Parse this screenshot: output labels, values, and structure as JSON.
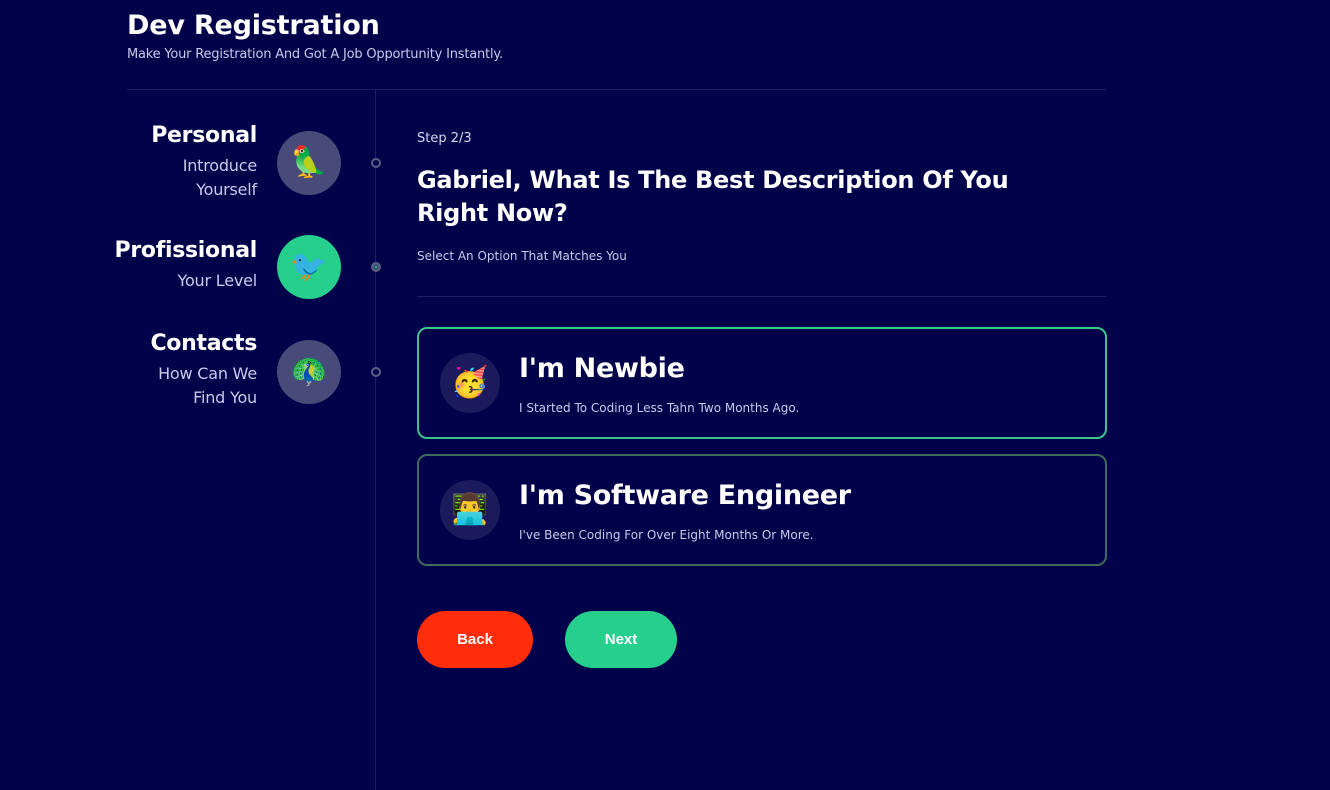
{
  "header": {
    "title": "Dev Registration",
    "subtitle": "Make Your Registration And Got A Job Opportunity Instantly."
  },
  "steps": [
    {
      "title": "Personal",
      "subtitle_line1": "Introduce",
      "subtitle_line2": "Yourself",
      "icon": "parrot-icon",
      "glyph": "🦜",
      "active": false
    },
    {
      "title": "Profissional",
      "subtitle_line1": "Your Level",
      "subtitle_line2": "",
      "icon": "bird-icon",
      "glyph": "🐦",
      "active": true
    },
    {
      "title": "Contacts",
      "subtitle_line1": "How Can We",
      "subtitle_line2": "Find You",
      "icon": "peacock-icon",
      "glyph": "🦚",
      "active": false
    }
  ],
  "main": {
    "step_label": "Step 2/3",
    "question": "Gabriel, What Is The Best Description Of You Right Now?",
    "hint": "Select An Option That Matches You"
  },
  "options": [
    {
      "title": "I'm Newbie",
      "description": "I Started To Coding Less Tahn Two Months Ago.",
      "icon": "party-face-icon",
      "glyph": "🥳",
      "selected": true
    },
    {
      "title": "I'm Software Engineer",
      "description": "I've Been Coding For Over Eight Months Or More.",
      "icon": "technologist-icon",
      "glyph": "👨‍💻",
      "selected": false
    }
  ],
  "buttons": {
    "back_label": "Back",
    "next_label": "Next"
  },
  "colors": {
    "background": "#02024a",
    "accent_green": "#27cf8c",
    "back_red": "#ff2d0a",
    "inactive_avatar": "#484a7a"
  }
}
